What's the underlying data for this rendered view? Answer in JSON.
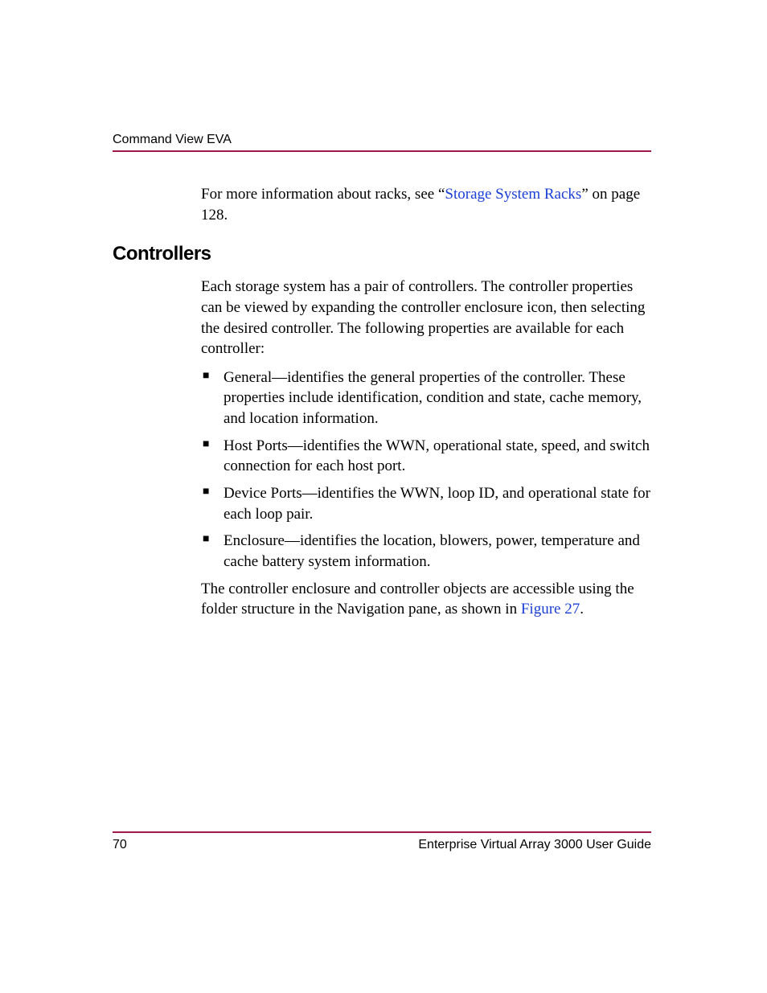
{
  "header": {
    "running_head": "Command View EVA"
  },
  "intro": {
    "pre": "For more information about racks, see “",
    "link": "Storage System Racks",
    "post": "” on page 128."
  },
  "section": {
    "heading": "Controllers",
    "lead": "Each storage system has a pair of controllers. The controller properties can be viewed by expanding the controller enclosure icon, then selecting the desired controller. The following properties are available for each controller:",
    "bullets": [
      "General—identifies the general properties of the controller. These properties include identification, condition and state, cache memory, and location information.",
      "Host Ports—identifies the WWN, operational state, speed, and switch connection for each host port.",
      "Device Ports—identifies the WWN, loop ID, and operational state for each loop pair.",
      "Enclosure—identifies the location, blowers, power, temperature and cache battery system information."
    ],
    "trailing_pre": "The controller enclosure and controller objects are accessible using the folder structure in the Navigation pane, as shown in ",
    "trailing_link": "Figure 27",
    "trailing_post": "."
  },
  "footer": {
    "page_number": "70",
    "doc_title": "Enterprise Virtual Array 3000 User Guide"
  }
}
